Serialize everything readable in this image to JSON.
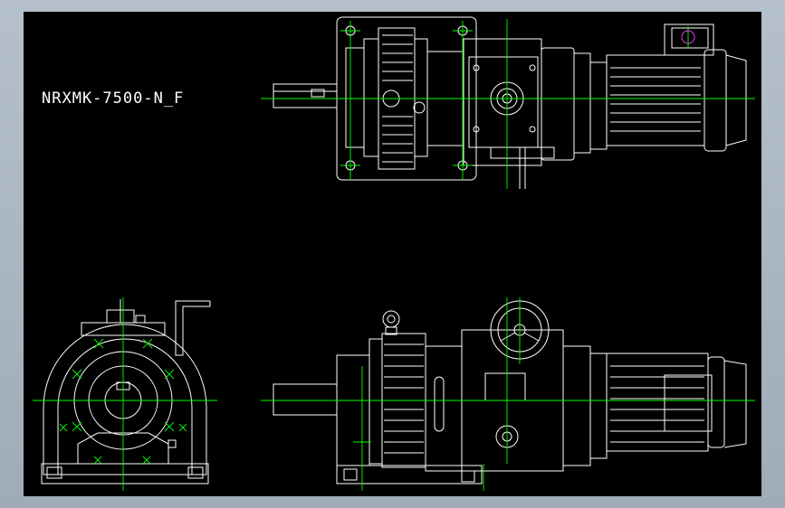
{
  "drawing": {
    "title": "NRXMK-7500-N_F",
    "colors": {
      "background": "#000000",
      "outline": "#ffffff",
      "centerline": "#00ff00",
      "highlight": "#ff33ff",
      "frame": "#a8b4c0"
    }
  },
  "views": [
    {
      "name": "top-view"
    },
    {
      "name": "end-view"
    },
    {
      "name": "front-view"
    }
  ]
}
